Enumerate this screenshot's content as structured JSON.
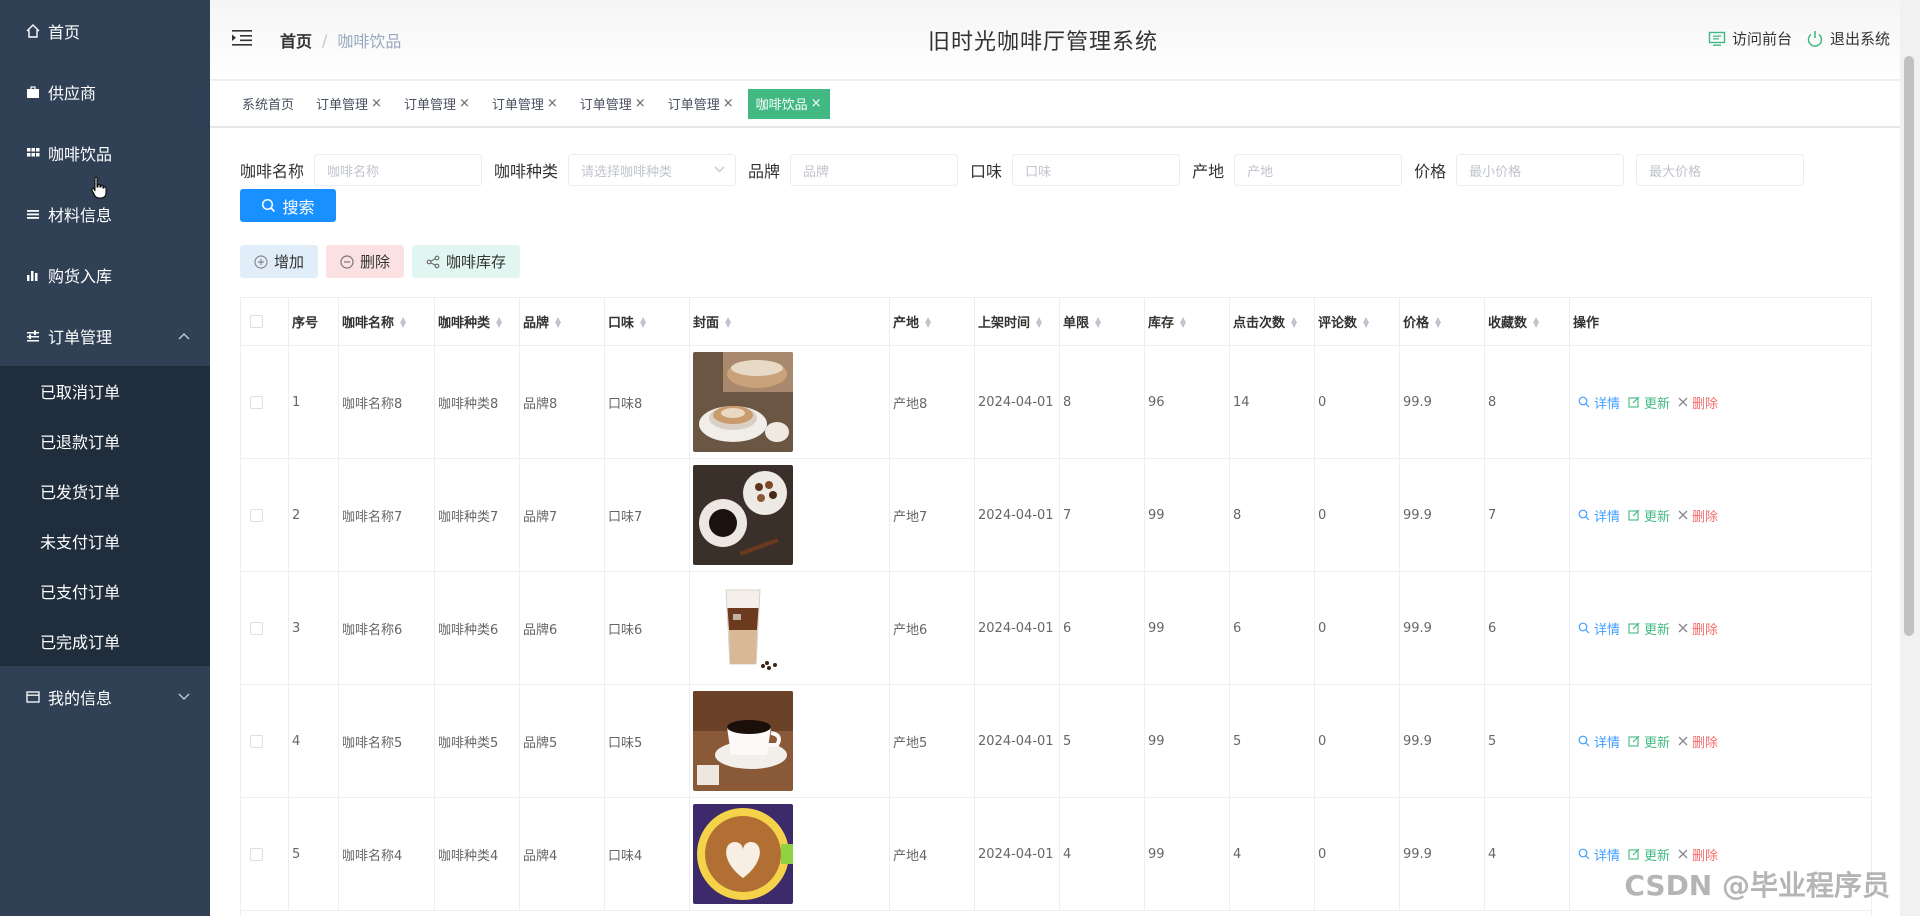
{
  "sidebar": {
    "items": [
      {
        "label": "首页",
        "icon": "home-icon"
      },
      {
        "label": "供应商",
        "icon": "briefcase-icon"
      },
      {
        "label": "咖啡饮品",
        "icon": "grid-icon"
      },
      {
        "label": "材料信息",
        "icon": "list-icon"
      },
      {
        "label": "购货入库",
        "icon": "bar-chart-icon"
      },
      {
        "label": "订单管理",
        "icon": "sliders-icon"
      }
    ],
    "order_submenu": [
      "已取消订单",
      "已退款订单",
      "已发货订单",
      "未支付订单",
      "已支付订单",
      "已完成订单"
    ],
    "my_info": "我的信息"
  },
  "header": {
    "breadcrumb_home": "首页",
    "breadcrumb_sep": "/",
    "breadcrumb_current": "咖啡饮品",
    "title": "旧时光咖啡厅管理系统",
    "visit_front": "访问前台",
    "logout": "退出系统"
  },
  "tags": {
    "home": "系统首页",
    "items": [
      "订单管理",
      "订单管理",
      "订单管理",
      "订单管理",
      "订单管理"
    ],
    "active": "咖啡饮品",
    "close": "×"
  },
  "search": {
    "name_label": "咖啡名称",
    "name_placeholder": "咖啡名称",
    "type_label": "咖啡种类",
    "type_placeholder": "请选择咖啡种类",
    "brand_label": "品牌",
    "brand_placeholder": "品牌",
    "flavor_label": "口味",
    "flavor_placeholder": "口味",
    "origin_label": "产地",
    "origin_placeholder": "产地",
    "price_label": "价格",
    "min_price_placeholder": "最小价格",
    "max_price_placeholder": "最大价格",
    "button": "搜索"
  },
  "actions": {
    "add": "增加",
    "delete": "删除",
    "stock": "咖啡库存"
  },
  "table": {
    "headers": [
      "序号",
      "咖啡名称",
      "咖啡种类",
      "品牌",
      "口味",
      "封面",
      "产地",
      "上架时间",
      "单限",
      "库存",
      "点击次数",
      "评论数",
      "价格",
      "收藏数",
      "操作"
    ],
    "rows": [
      {
        "idx": "1",
        "name": "咖啡名称8",
        "type": "咖啡种类8",
        "brand": "品牌8",
        "flavor": "口味8",
        "origin": "产地8",
        "date": "2024-04-01",
        "limit": "8",
        "stock": "96",
        "clicks": "14",
        "reviews": "0",
        "price": "99.9",
        "fav": "8"
      },
      {
        "idx": "2",
        "name": "咖啡名称7",
        "type": "咖啡种类7",
        "brand": "品牌7",
        "flavor": "口味7",
        "origin": "产地7",
        "date": "2024-04-01",
        "limit": "7",
        "stock": "99",
        "clicks": "8",
        "reviews": "0",
        "price": "99.9",
        "fav": "7"
      },
      {
        "idx": "3",
        "name": "咖啡名称6",
        "type": "咖啡种类6",
        "brand": "品牌6",
        "flavor": "口味6",
        "origin": "产地6",
        "date": "2024-04-01",
        "limit": "6",
        "stock": "99",
        "clicks": "6",
        "reviews": "0",
        "price": "99.9",
        "fav": "6"
      },
      {
        "idx": "4",
        "name": "咖啡名称5",
        "type": "咖啡种类5",
        "brand": "品牌5",
        "flavor": "口味5",
        "origin": "产地5",
        "date": "2024-04-01",
        "limit": "5",
        "stock": "99",
        "clicks": "5",
        "reviews": "0",
        "price": "99.9",
        "fav": "5"
      },
      {
        "idx": "5",
        "name": "咖啡名称4",
        "type": "咖啡种类4",
        "brand": "品牌4",
        "flavor": "口味4",
        "origin": "产地4",
        "date": "2024-04-01",
        "limit": "4",
        "stock": "99",
        "clicks": "4",
        "reviews": "0",
        "price": "99.9",
        "fav": "4"
      }
    ],
    "row_actions": {
      "detail": "详情",
      "update": "更新",
      "delete": "删除"
    }
  },
  "watermark": "CSDN @毕业程序员",
  "colors": {
    "sidebar": "#304156",
    "submenu": "#1f2d3d",
    "primary": "#1890ff",
    "active_tag": "#42b983",
    "danger": "#f56c6c"
  }
}
